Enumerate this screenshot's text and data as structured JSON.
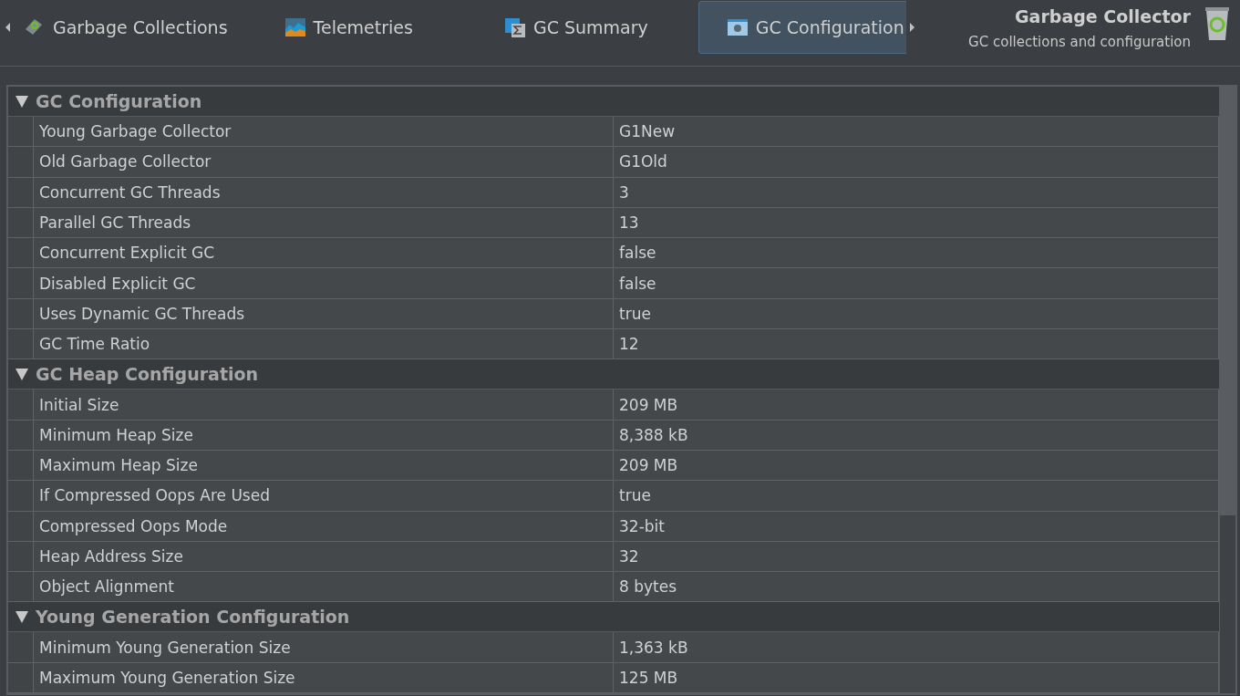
{
  "tabs": [
    {
      "label": "Garbage Collections",
      "kind": "gc",
      "selected": false
    },
    {
      "label": "Telemetries",
      "kind": "chart",
      "selected": false
    },
    {
      "label": "GC Summary",
      "kind": "sum",
      "selected": false
    },
    {
      "label": "GC Configuration",
      "kind": "config",
      "selected": true
    }
  ],
  "header": {
    "title": "Garbage Collector",
    "subtitle": "GC collections and configuration"
  },
  "sections": [
    {
      "title": "GC Configuration",
      "expanded": true,
      "rows": [
        {
          "name": "Young Garbage Collector",
          "value": "G1New"
        },
        {
          "name": "Old Garbage Collector",
          "value": "G1Old"
        },
        {
          "name": "Concurrent GC Threads",
          "value": "3"
        },
        {
          "name": "Parallel GC Threads",
          "value": "13"
        },
        {
          "name": "Concurrent Explicit GC",
          "value": "false"
        },
        {
          "name": "Disabled Explicit GC",
          "value": "false"
        },
        {
          "name": "Uses Dynamic GC Threads",
          "value": "true"
        },
        {
          "name": "GC Time Ratio",
          "value": "12"
        }
      ]
    },
    {
      "title": "GC Heap Configuration",
      "expanded": true,
      "rows": [
        {
          "name": "Initial Size",
          "value": "209 MB"
        },
        {
          "name": "Minimum Heap Size",
          "value": "8,388 kB"
        },
        {
          "name": "Maximum Heap Size",
          "value": "209 MB"
        },
        {
          "name": "If Compressed Oops Are Used",
          "value": "true"
        },
        {
          "name": "Compressed Oops Mode",
          "value": "32-bit"
        },
        {
          "name": "Heap Address Size",
          "value": "32"
        },
        {
          "name": "Object Alignment",
          "value": "8 bytes"
        }
      ]
    },
    {
      "title": "Young Generation Configuration",
      "expanded": true,
      "rows": [
        {
          "name": "Minimum Young Generation Size",
          "value": "1,363 kB"
        },
        {
          "name": "Maximum Young Generation Size",
          "value": "125 MB"
        }
      ]
    }
  ]
}
